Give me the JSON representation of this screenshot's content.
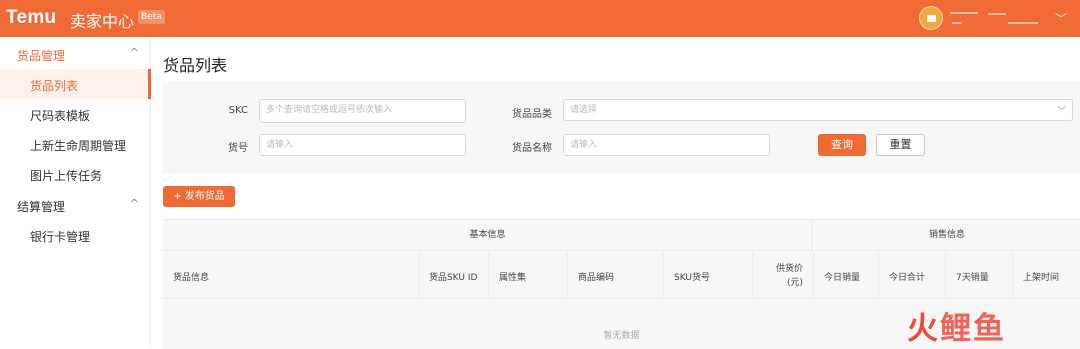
{
  "topbar": {
    "logo": "Temu",
    "title": "卖家中心",
    "badge": "Beta",
    "chevron": "﹀"
  },
  "sidebar": {
    "groups": [
      {
        "label": "货品管理",
        "chevron": "^",
        "items": [
          "货品列表",
          "尺码表模板",
          "上新生命周期管理",
          "图片上传任务"
        ]
      },
      {
        "label": "结算管理",
        "chevron": "^",
        "items": [
          "银行卡管理"
        ]
      }
    ]
  },
  "main": {
    "title": "货品列表",
    "filters": {
      "skc_label": "SKC",
      "skc_placeholder": "多个查询请空格或逗号依次输入",
      "category_label": "货品品类",
      "category_placeholder": "请选择",
      "item_no_label": "货号",
      "item_no_placeholder": "请输入",
      "name_label": "货品名称",
      "name_placeholder": "请输入",
      "query": "查询",
      "reset": "重置"
    },
    "publish_button": "+ 发布货品",
    "table": {
      "group_basic": "基本信息",
      "group_sales": "销售信息",
      "columns": [
        "货品信息",
        "货品SKU ID",
        "属性集",
        "商品编码",
        "SKU货号",
        "供货价",
        "(元)",
        "今日销量",
        "今日合计",
        "7天销量",
        "上架时间"
      ],
      "empty": "暂无数据"
    }
  },
  "watermark": {
    "part1": "火",
    "part2": "鲤鱼"
  }
}
